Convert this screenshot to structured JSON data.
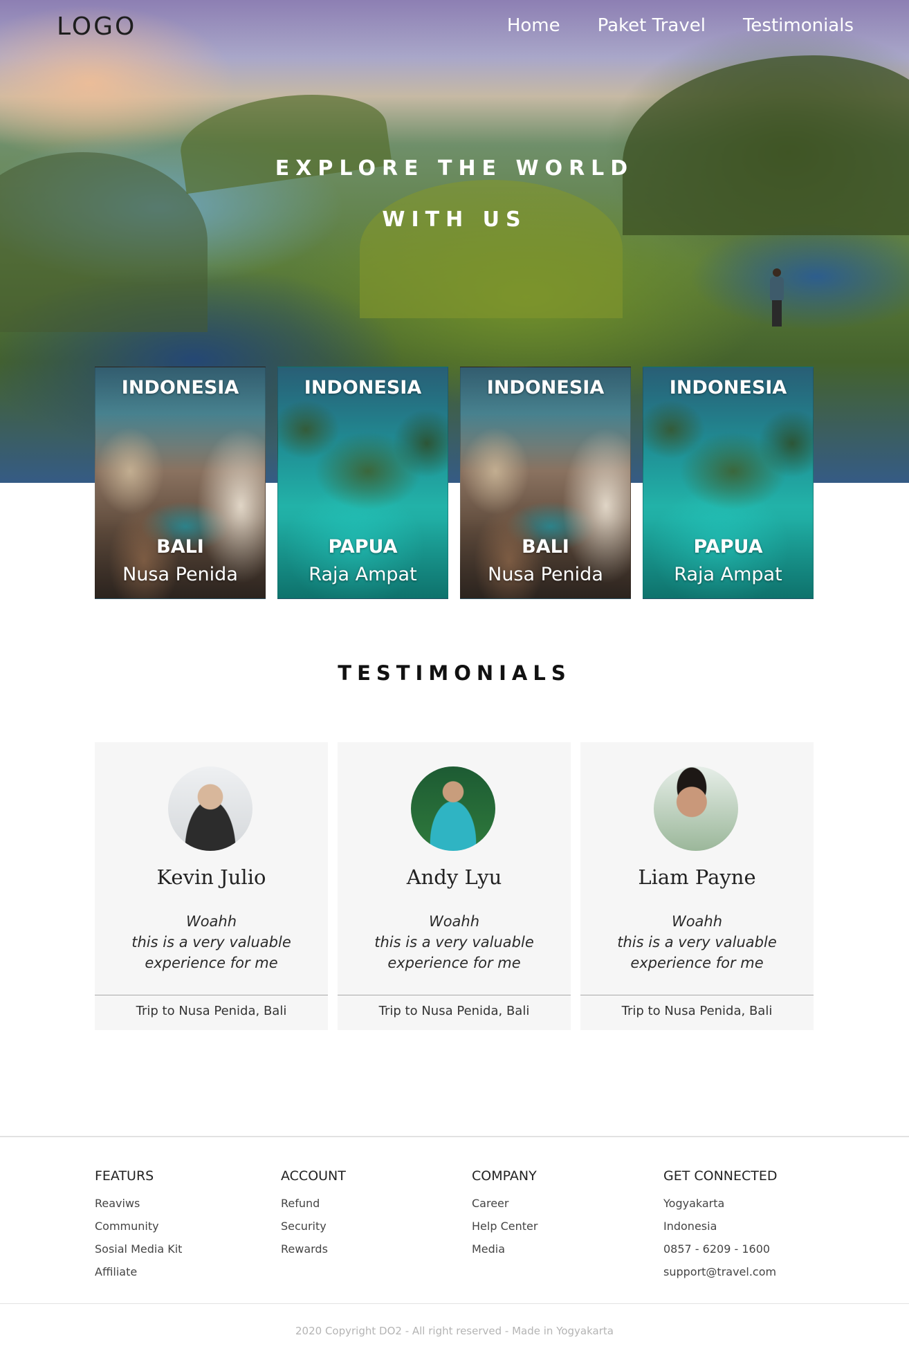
{
  "nav": {
    "logo": "LOGO",
    "links": [
      "Home",
      "Paket Travel",
      "Testimonials"
    ]
  },
  "hero": {
    "title_line1": "EXPLORE THE WORLD",
    "title_line2": "WITH US"
  },
  "destinations": [
    {
      "country": "INDONESIA",
      "region": "BALI",
      "place": "Nusa Penida",
      "image": "bali-coast"
    },
    {
      "country": "INDONESIA",
      "region": "PAPUA",
      "place": "Raja Ampat",
      "image": "papua-islands"
    },
    {
      "country": "INDONESIA",
      "region": "BALI",
      "place": "Nusa Penida",
      "image": "bali-coast"
    },
    {
      "country": "INDONESIA",
      "region": "PAPUA",
      "place": "Raja Ampat",
      "image": "papua-islands"
    }
  ],
  "testimonials": {
    "title": "TESTIMONIALS",
    "items": [
      {
        "name": "Kevin Julio",
        "quote_line1": "Woahh",
        "quote_line2": "this is a very valuable",
        "quote_line3": "experience for me",
        "trip": "Trip to Nusa Penida, Bali"
      },
      {
        "name": "Andy Lyu",
        "quote_line1": "Woahh",
        "quote_line2": "this is a very valuable",
        "quote_line3": "experience for me",
        "trip": "Trip to Nusa Penida, Bali"
      },
      {
        "name": "Liam Payne",
        "quote_line1": "Woahh",
        "quote_line2": "this is a very valuable",
        "quote_line3": "experience for me",
        "trip": "Trip to Nusa Penida, Bali"
      }
    ]
  },
  "footer": {
    "columns": [
      {
        "heading": "FEATURS",
        "items": [
          "Reaviws",
          "Community",
          "Sosial Media Kit",
          "Affiliate"
        ]
      },
      {
        "heading": "ACCOUNT",
        "items": [
          "Refund",
          "Security",
          "Rewards"
        ]
      },
      {
        "heading": "COMPANY",
        "items": [
          "Career",
          "Help Center",
          "Media"
        ]
      },
      {
        "heading": "GET CONNECTED",
        "items": [
          "Yogyakarta",
          "Indonesia",
          "0857 - 6209 - 1600",
          "support@travel.com"
        ]
      }
    ],
    "copyright": "2020 Copyright DO2  - All right reserved - Made in Yogyakarta"
  }
}
